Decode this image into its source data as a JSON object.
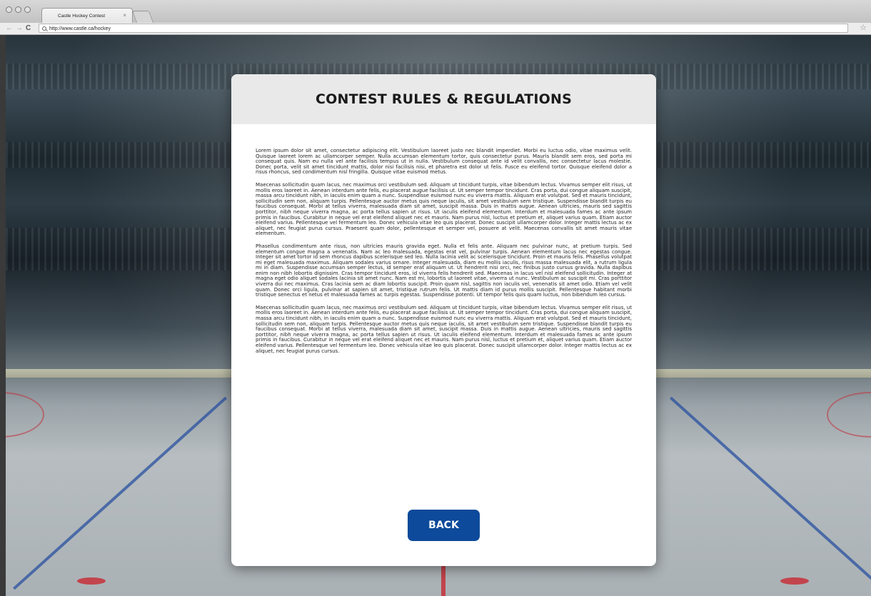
{
  "browser": {
    "tab_title": "Castle Hockey Contest",
    "tab_close": "×",
    "url": "http://www.castle.ca/hockey",
    "nav_back": "←",
    "nav_forward": "→",
    "nav_reload": "C",
    "star": "☆"
  },
  "modal": {
    "title": "CONTEST RULES & REGULATIONS",
    "paragraphs": [
      "Lorem ipsum dolor sit amet, consectetur adipiscing elit. Vestibulum laoreet justo nec blandit imperdiet. Morbi eu luctus odio, vitae maximus velit. Quisque laoreet lorem ac ullamcorper semper. Nulla accumsan elementum tortor, quis consectetur purus. Mauris blandit sem eros, sed porta mi consequat quis. Nam eu nulla vel ante facilisis tempus ut in nulla. Vestibulum consequat ante id velit convallis, nec consectetur lacus molestie. Donec porta, velit sit amet tincidunt mattis, dolor nisi facilisis nisi, et pharetra est dolor ut felis. Fusce eu eleifend tortor. Quisque eleifend dolor a risus rhoncus, sed condimentum nisl fringilla. Quisque vitae euismod metus.",
      "Maecenas sollicitudin quam lacus, nec maximus orci vestibulum sed. Aliquam ut tincidunt turpis, vitae bibendum lectus. Vivamus semper elit risus, ut mollis eros laoreet in. Aenean interdum ante felis, eu placerat augue facilisis ut. Ut semper tempor tincidunt. Cras porta, dui congue aliquam suscipit, massa arcu tincidunt nibh, in iaculis enim quam a nunc. Suspendisse euismod nunc eu viverra mattis. Aliquam erat volutpat. Sed et mauris tincidunt, sollicitudin sem non, aliquam turpis. Pellentesque auctor metus quis neque iaculis, sit amet vestibulum sem tristique. Suspendisse blandit turpis eu faucibus consequat. Morbi at tellus viverra, malesuada diam sit amet, suscipit massa. Duis in mattis augue. Aenean ultricies, mauris sed sagittis porttitor, nibh neque viverra magna, ac porta tellus sapien ut risus. Ut iaculis eleifend elementum. Interdum et malesuada fames ac ante ipsum primis in faucibus. Curabitur in neque vel erat eleifend aliquet nec et mauris. Nam purus nisl, luctus et pretium et, aliquet varius quam. Etiam auctor eleifend varius. Pellentesque vel fermentum leo. Donec vehicula vitae leo quis placerat. Donec suscipit ullamcorper dolor. Integer mattis lectus ac ex aliquet, nec feugiat purus cursus. Praesent quam dolor, pellentesque et semper vel, posuere at velit. Maecenas convallis sit amet mauris vitae elementum.",
      "Phasellus condimentum ante risus, non ultricies mauris gravida eget. Nulla et felis ante. Aliquam nec pulvinar nunc, at pretium turpis. Sed elementum congue magna a venenatis. Nam ac leo malesuada, egestas erat vel, pulvinar turpis. Aenean elementum lacus nec egestas congue. Integer sit amet tortor id sem rhoncus dapibus scelerisque sed leo. Nulla lacinia velit ac scelerisque tincidunt. Proin et mauris felis. Phasellus volutpat mi eget malesuada maximus. Aliquam sodales varius ornare. Integer malesuada, diam eu mollis iaculis, risus massa malesuada elit, a rutrum ligula mi in diam. Suspendisse accumsan semper lectus, id semper erat aliquam ut. Ut hendrerit nisi orci, nec finibus justo cursus gravida. Nulla dapibus enim non nibh lobortis dignissim. Cras tempor tincidunt eros, id viverra felis hendrerit sed. Maecenas in lacus vel nisl eleifend sollicitudin. Integer at magna eget odio aliquet sodales lacinia sit amet nunc. Nam est mi, lobortis ut laoreet vitae, viverra ut nunc. Vestibulum ac suscipit mi. Cras porttitor viverra dui nec maximus. Cras lacinia sem ac diam lobortis suscipit. Proin quam nisl, sagittis non iaculis vel, venenatis sit amet odio. Etiam vel velit quam. Donec orci ligula, pulvinar at sapien sit amet, tristique rutrum felis. Ut mattis diam id purus mollis suscipit. Pellentesque habitant morbi tristique senectus et netus et malesuada fames ac turpis egestas. Suspendisse potenti. Ut tempor felis quis quam luctus, non bibendum leo cursus.",
      "Maecenas sollicitudin quam lacus, nec maximus orci vestibulum sed. Aliquam ut tincidunt turpis, vitae bibendum lectus. Vivamus semper elit risus, ut mollis eros laoreet in. Aenean interdum ante felis, eu placerat augue facilisis ut. Ut semper tempor tincidunt. Cras porta, dui congue aliquam suscipit, massa arcu tincidunt nibh, in iaculis enim quam a nunc. Suspendisse euismod nunc eu viverra mattis. Aliquam erat volutpat. Sed et mauris tincidunt, sollicitudin sem non, aliquam turpis. Pellentesque auctor metus quis neque iaculis, sit amet vestibulum sem tristique. Suspendisse blandit turpis eu faucibus consequat. Morbi at tellus viverra, malesuada diam sit amet, suscipit massa. Duis in mattis augue. Aenean ultricies, mauris sed sagittis porttitor, nibh neque viverra magna, ac porta tellus sapien ut risus. Ut iaculis eleifend elementum. Interdum et malesuada fames ac ante ipsum primis in faucibus. Curabitur in neque vel erat eleifend aliquet nec et mauris. Nam purus nisl, luctus et pretium et, aliquet varius quam. Etiam auctor eleifend varius. Pellentesque vel fermentum leo. Donec vehicula vitae leo quis placerat. Donec suscipit ullamcorper dolor. Integer mattis lectus ac ex aliquet, nec feugiat purus cursus."
    ],
    "back_label": "BACK"
  },
  "colors": {
    "button": "#0d4a9b",
    "header_bg": "#e9e9e9",
    "ice_blue_line": "#2850a0",
    "ice_red_line": "#c82832"
  },
  "icons": [
    "back-arrow-icon",
    "forward-arrow-icon",
    "reload-icon",
    "search-icon",
    "bookmark-star-icon",
    "tab-close-icon"
  ]
}
